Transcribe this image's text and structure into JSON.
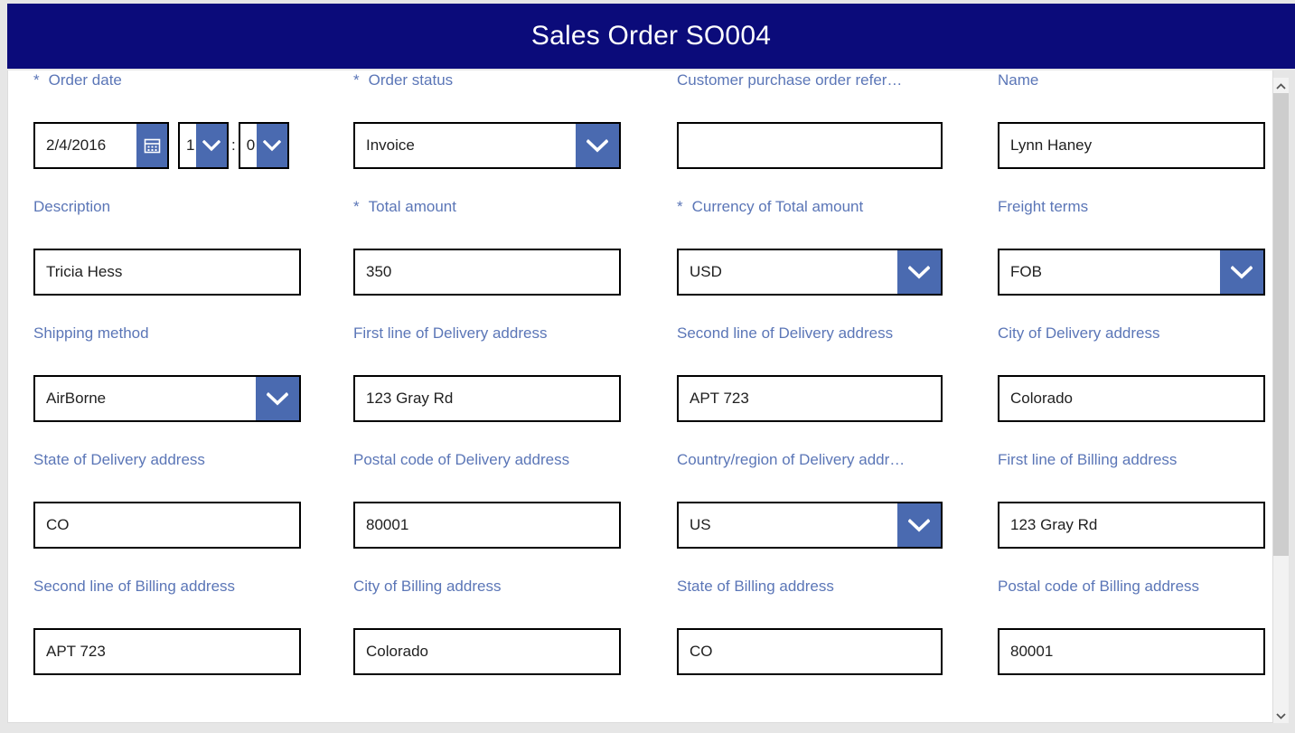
{
  "header": {
    "title": "Sales Order SO004",
    "background_color": "#0b0b7a",
    "text_color": "#ffffff"
  },
  "theme": {
    "label_color": "#5b76b7",
    "accent_button_color": "#4a6ab0",
    "input_border_color": "#000000",
    "page_background": "#e6e6e6",
    "panel_background": "#ffffff"
  },
  "form": {
    "rows": [
      {
        "fields": [
          {
            "label": "Order date",
            "required": true,
            "type": "datetime",
            "date_value": "2/4/2016",
            "hour_value": "1",
            "minute_value": "0",
            "time_separator": ":",
            "calendar_icon": "calendar-icon"
          },
          {
            "label": "Order status",
            "required": true,
            "type": "dropdown",
            "value": "Invoice",
            "chevron_icon": "chevron-down-icon"
          },
          {
            "label": "Customer purchase order refer…",
            "required": false,
            "type": "text",
            "value": "",
            "placeholder": ""
          },
          {
            "label": "Name",
            "required": false,
            "type": "text",
            "value": "Lynn Haney",
            "placeholder": ""
          }
        ]
      },
      {
        "fields": [
          {
            "label": "Description",
            "required": false,
            "type": "text",
            "value": "Tricia Hess",
            "placeholder": ""
          },
          {
            "label": "Total amount",
            "required": true,
            "type": "text",
            "value": "350",
            "placeholder": ""
          },
          {
            "label": "Currency of Total amount",
            "required": true,
            "type": "dropdown",
            "value": "USD",
            "chevron_icon": "chevron-down-icon"
          },
          {
            "label": "Freight terms",
            "required": false,
            "type": "dropdown",
            "value": "FOB",
            "chevron_icon": "chevron-down-icon"
          }
        ]
      },
      {
        "fields": [
          {
            "label": "Shipping method",
            "required": false,
            "type": "dropdown",
            "value": "AirBorne",
            "chevron_icon": "chevron-down-icon"
          },
          {
            "label": "First line of Delivery address",
            "required": false,
            "type": "text",
            "value": "123 Gray Rd",
            "placeholder": ""
          },
          {
            "label": "Second line of Delivery address",
            "required": false,
            "type": "text",
            "value": "APT 723",
            "placeholder": ""
          },
          {
            "label": "City of Delivery address",
            "required": false,
            "type": "text",
            "value": "Colorado",
            "placeholder": ""
          }
        ]
      },
      {
        "fields": [
          {
            "label": "State of Delivery address",
            "required": false,
            "type": "text",
            "value": "CO",
            "placeholder": ""
          },
          {
            "label": "Postal code of Delivery address",
            "required": false,
            "type": "text",
            "value": "80001",
            "placeholder": ""
          },
          {
            "label": "Country/region of Delivery addr…",
            "required": false,
            "type": "dropdown",
            "value": "US",
            "chevron_icon": "chevron-down-icon"
          },
          {
            "label": "First line of Billing address",
            "required": false,
            "type": "text",
            "value": "123 Gray Rd",
            "placeholder": ""
          }
        ]
      },
      {
        "fields": [
          {
            "label": "Second line of Billing address",
            "required": false,
            "type": "text",
            "value": "APT 723",
            "placeholder": ""
          },
          {
            "label": "City of Billing address",
            "required": false,
            "type": "text",
            "value": "Colorado",
            "placeholder": ""
          },
          {
            "label": "State of Billing address",
            "required": false,
            "type": "text",
            "value": "CO",
            "placeholder": ""
          },
          {
            "label": "Postal code of Billing address",
            "required": false,
            "type": "text",
            "value": "80001",
            "placeholder": ""
          }
        ]
      }
    ],
    "required_marker": "*"
  },
  "scrollbar": {
    "up_arrow_icon": "chevron-up-icon",
    "down_arrow_icon": "chevron-down-icon",
    "orientation": "vertical"
  }
}
